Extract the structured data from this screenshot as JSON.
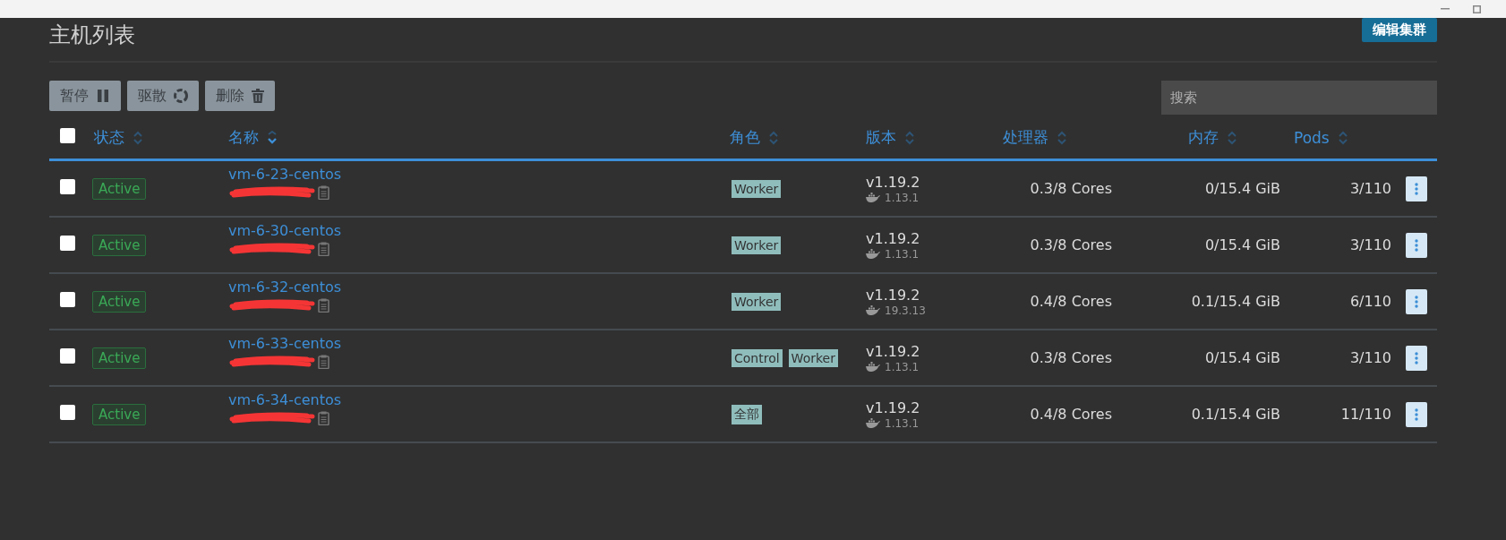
{
  "page": {
    "title": "主机列表",
    "edit_button": "编辑集群"
  },
  "actions": [
    {
      "label": "暂停",
      "kind": "pause"
    },
    {
      "label": "驱散",
      "kind": "drain"
    },
    {
      "label": "删除",
      "kind": "delete"
    }
  ],
  "search": {
    "placeholder": "搜索"
  },
  "table": {
    "select_all": {
      "checked": false
    },
    "columns": [
      {
        "label": "状态",
        "sorted": false
      },
      {
        "label": "名称",
        "sorted": true
      },
      {
        "label": "角色",
        "sorted": false
      },
      {
        "label": "版本",
        "sorted": false
      },
      {
        "label": "处理器",
        "sorted": false
      },
      {
        "label": "内存",
        "sorted": false
      },
      {
        "label": "Pods",
        "sorted": false
      }
    ],
    "rows": [
      {
        "checked": false,
        "status": "Active",
        "name": "vm-6-23-centos",
        "roles": [
          "Worker"
        ],
        "version": "v1.19.2",
        "docker": "1.13.1",
        "cpu": "0.3/8 Cores",
        "memory": "0/15.4 GiB",
        "pods": "3/110"
      },
      {
        "checked": false,
        "status": "Active",
        "name": "vm-6-30-centos",
        "roles": [
          "Worker"
        ],
        "version": "v1.19.2",
        "docker": "1.13.1",
        "cpu": "0.3/8 Cores",
        "memory": "0/15.4 GiB",
        "pods": "3/110"
      },
      {
        "checked": false,
        "status": "Active",
        "name": "vm-6-32-centos",
        "roles": [
          "Worker"
        ],
        "version": "v1.19.2",
        "docker": "19.3.13",
        "cpu": "0.4/8 Cores",
        "memory": "0.1/15.4 GiB",
        "pods": "6/110"
      },
      {
        "checked": false,
        "status": "Active",
        "name": "vm-6-33-centos",
        "roles": [
          "Control",
          "Worker"
        ],
        "version": "v1.19.2",
        "docker": "1.13.1",
        "cpu": "0.3/8 Cores",
        "memory": "0/15.4 GiB",
        "pods": "3/110"
      },
      {
        "checked": false,
        "status": "Active",
        "name": "vm-6-34-centos",
        "roles": [
          "全部"
        ],
        "version": "v1.19.2",
        "docker": "1.13.1",
        "cpu": "0.4/8 Cores",
        "memory": "0.1/15.4 GiB",
        "pods": "11/110"
      }
    ]
  }
}
